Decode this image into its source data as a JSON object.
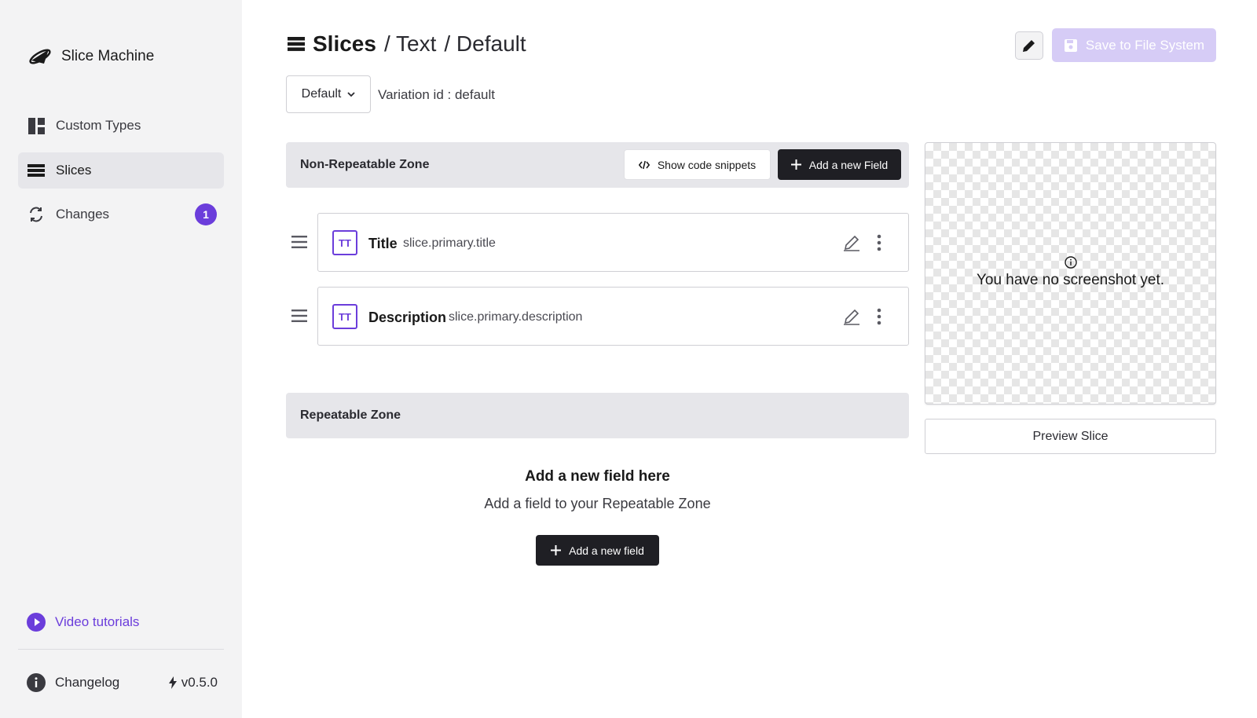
{
  "sidebar": {
    "brand": "Slice Machine",
    "items": [
      {
        "label": "Custom Types",
        "icon": "layout-icon"
      },
      {
        "label": "Slices",
        "icon": "slices-icon",
        "active": true
      },
      {
        "label": "Changes",
        "icon": "sync-icon",
        "badge": "1"
      }
    ],
    "video_tutorials": "Video tutorials",
    "changelog": "Changelog",
    "version": "v0.5.0"
  },
  "header": {
    "root": "Slices",
    "crumb1": "/ Text",
    "crumb2": "/ Default",
    "save_label": "Save to File System"
  },
  "variation": {
    "selected": "Default",
    "id_text": "Variation id : default"
  },
  "non_repeatable": {
    "title": "Non-Repeatable Zone",
    "snippets_label": "Show code snippets",
    "add_label": "Add a new Field",
    "fields": [
      {
        "icon_text": "TT",
        "label": "Title",
        "path": "slice.primary.title"
      },
      {
        "icon_text": "TT",
        "label": "Description",
        "path": "slice.primary.description"
      }
    ]
  },
  "repeatable": {
    "title": "Repeatable Zone",
    "empty_title": "Add a new field here",
    "empty_sub": "Add a field to your Repeatable Zone",
    "add_label": "Add a new field"
  },
  "screenshot": {
    "empty_text": "You have no screenshot yet.",
    "preview_label": "Preview Slice"
  },
  "colors": {
    "accent": "#6b3ddb",
    "dark_button": "#1f1f24",
    "save_disabled": "#d6ccf6"
  }
}
